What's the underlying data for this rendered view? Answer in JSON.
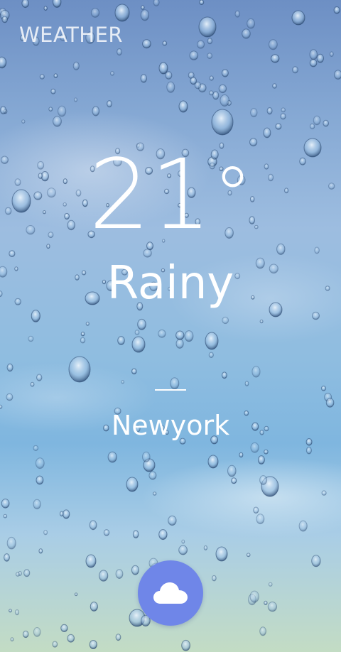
{
  "app": {
    "title": "WEATHER"
  },
  "weather": {
    "temperature": "21",
    "degree_symbol": "°",
    "condition": "Rainy",
    "city": "Newyork"
  },
  "icons": {
    "fab_icon": "cloud-icon"
  },
  "colors": {
    "fab": "#6f86e8",
    "text": "#ffffff"
  }
}
